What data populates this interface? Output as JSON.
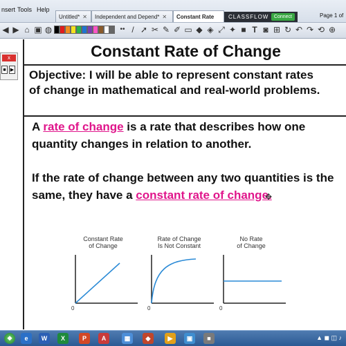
{
  "menus": [
    "nsert",
    "Tools",
    "Help"
  ],
  "tabs": [
    {
      "label": "Untitled*",
      "active": false
    },
    {
      "label": "Independent and Depend*",
      "active": false
    },
    {
      "label": "Constant Rate",
      "active": true
    }
  ],
  "classflow": {
    "label": "CLASSFLOW",
    "connect": "Connect"
  },
  "page_indicator": "Page 1 of",
  "palette": [
    "#000000",
    "#e11c1c",
    "#f28c1f",
    "#f5e11e",
    "#2ab34a",
    "#1f74d1",
    "#7b3fb0",
    "#ff56c6",
    "#8a5a2b",
    "#ffffff",
    "#666666"
  ],
  "left_panel": {
    "close": "x"
  },
  "slide": {
    "title": "Constant Rate of Change",
    "objective": "Objective: I will be able to represent constant rates of change in mathematical and real-world problems.",
    "p1_prefix": "A ",
    "p1_term": "rate of change",
    "p1_rest": " is a rate that describes how one quantity changes in relation to another.",
    "p2_text": "If the rate of change between any two quantities is the same, they have a ",
    "p2_term": "constant rate of change.",
    "accent": "#e0158b"
  },
  "graphs": [
    {
      "label_line1": "Constant Rate",
      "label_line2": "of Change",
      "curve": "line",
      "origin_label": "0"
    },
    {
      "label_line1": "Rate of Change",
      "label_line2": "Is Not Constant",
      "curve": "concave",
      "origin_label": "0"
    },
    {
      "label_line1": "No Rate",
      "label_line2": "of Change",
      "curve": "flat",
      "origin_label": "0"
    }
  ],
  "graph_color": "#2a8ad6"
}
